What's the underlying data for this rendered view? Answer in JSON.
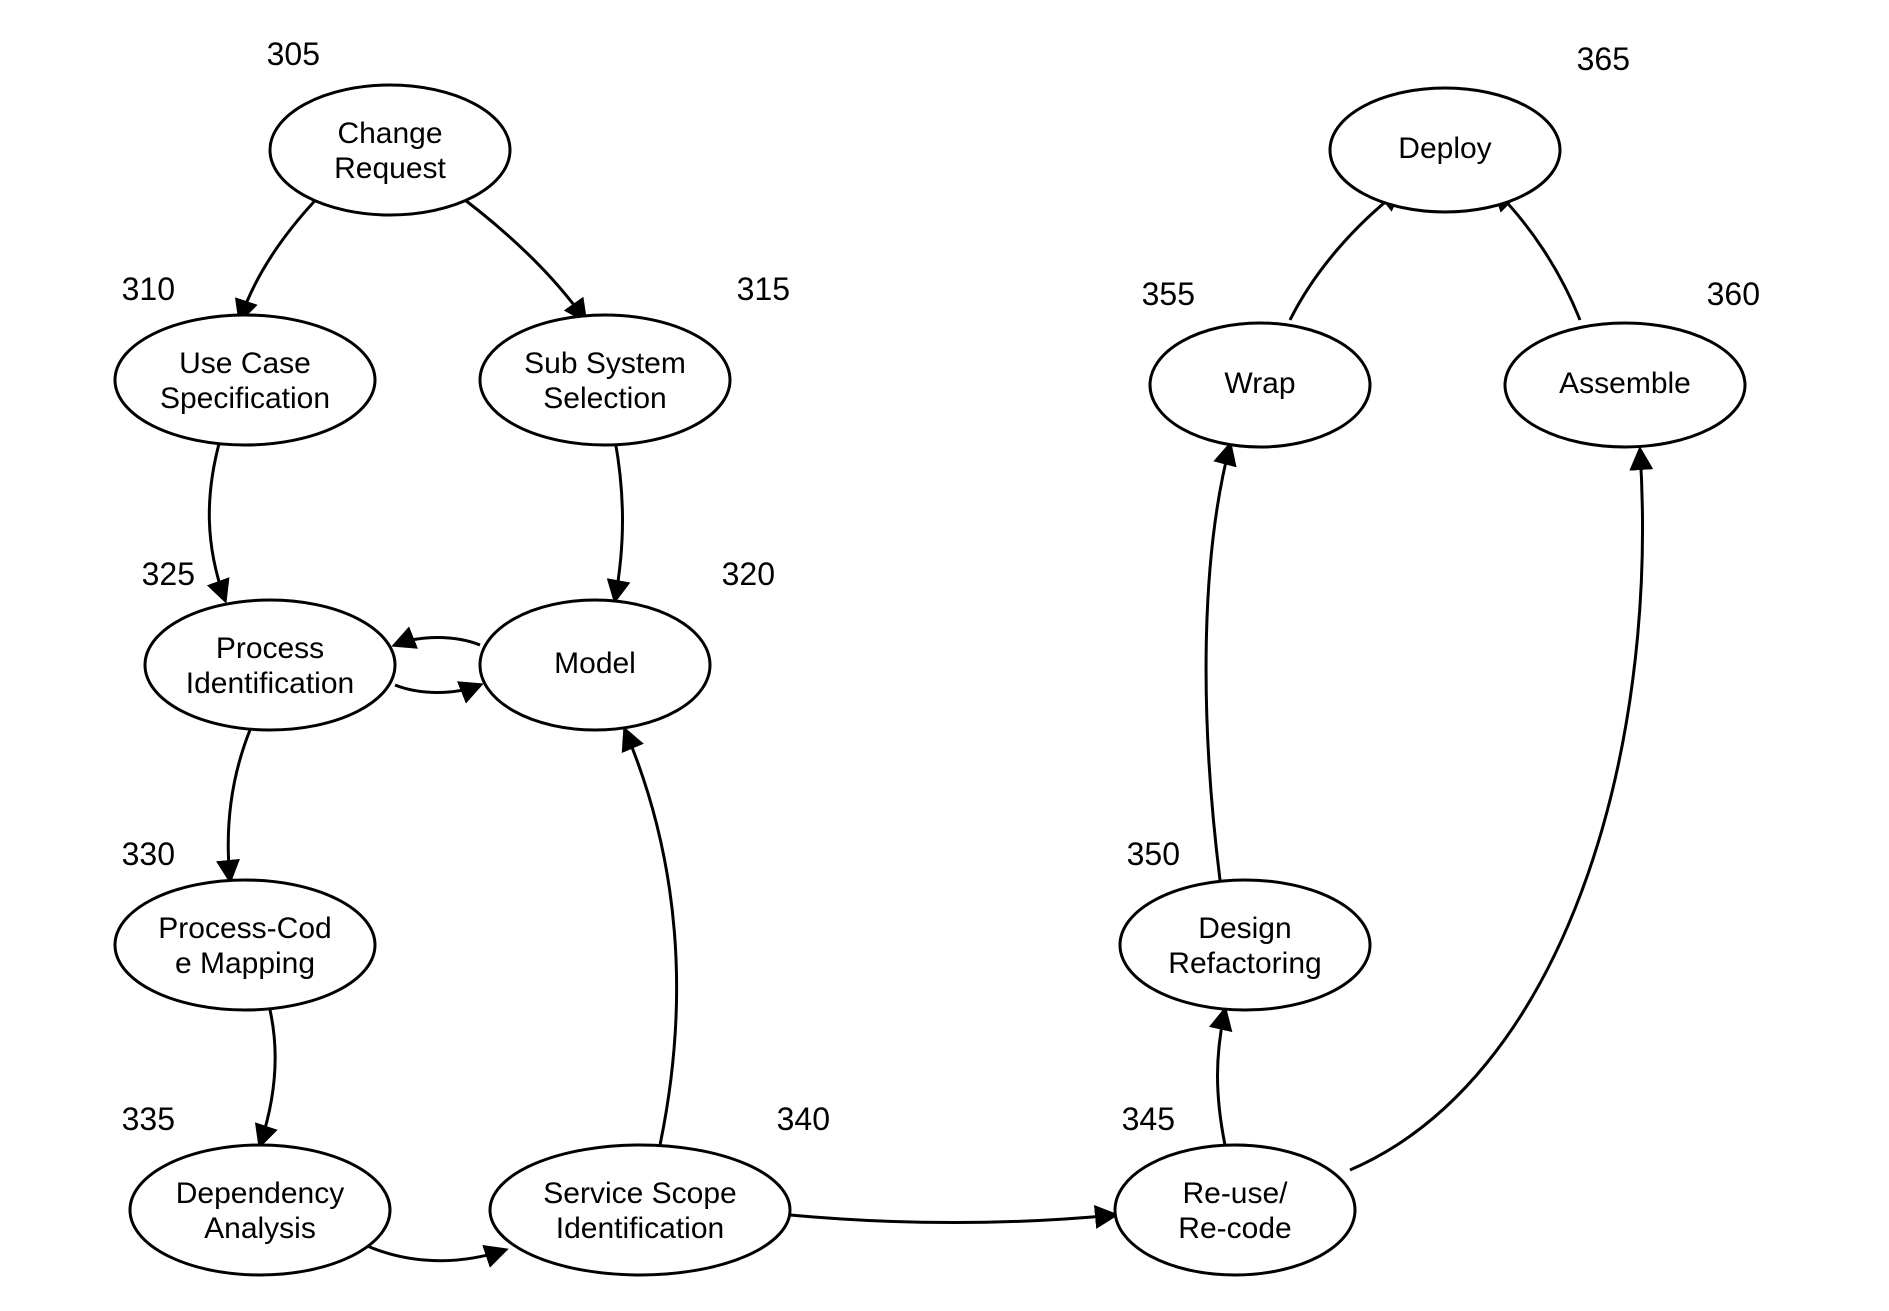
{
  "diagram": {
    "nodes": {
      "n305": {
        "num": "305",
        "lines": [
          "Change",
          "Request"
        ]
      },
      "n310": {
        "num": "310",
        "lines": [
          "Use Case",
          "Specification"
        ]
      },
      "n315": {
        "num": "315",
        "lines": [
          "Sub System",
          "Selection"
        ]
      },
      "n320": {
        "num": "320",
        "lines": [
          "Model"
        ]
      },
      "n325": {
        "num": "325",
        "lines": [
          "Process",
          "Identification"
        ]
      },
      "n330": {
        "num": "330",
        "lines": [
          "Process-Cod",
          "e Mapping"
        ]
      },
      "n335": {
        "num": "335",
        "lines": [
          "Dependency",
          "Analysis"
        ]
      },
      "n340": {
        "num": "340",
        "lines": [
          "Service Scope",
          "Identification"
        ]
      },
      "n345": {
        "num": "345",
        "lines": [
          "Re-use/",
          "Re-code"
        ]
      },
      "n350": {
        "num": "350",
        "lines": [
          "Design",
          "Refactoring"
        ]
      },
      "n355": {
        "num": "355",
        "lines": [
          "Wrap"
        ]
      },
      "n360": {
        "num": "360",
        "lines": [
          "Assemble"
        ]
      },
      "n365": {
        "num": "365",
        "lines": [
          "Deploy"
        ]
      }
    }
  }
}
